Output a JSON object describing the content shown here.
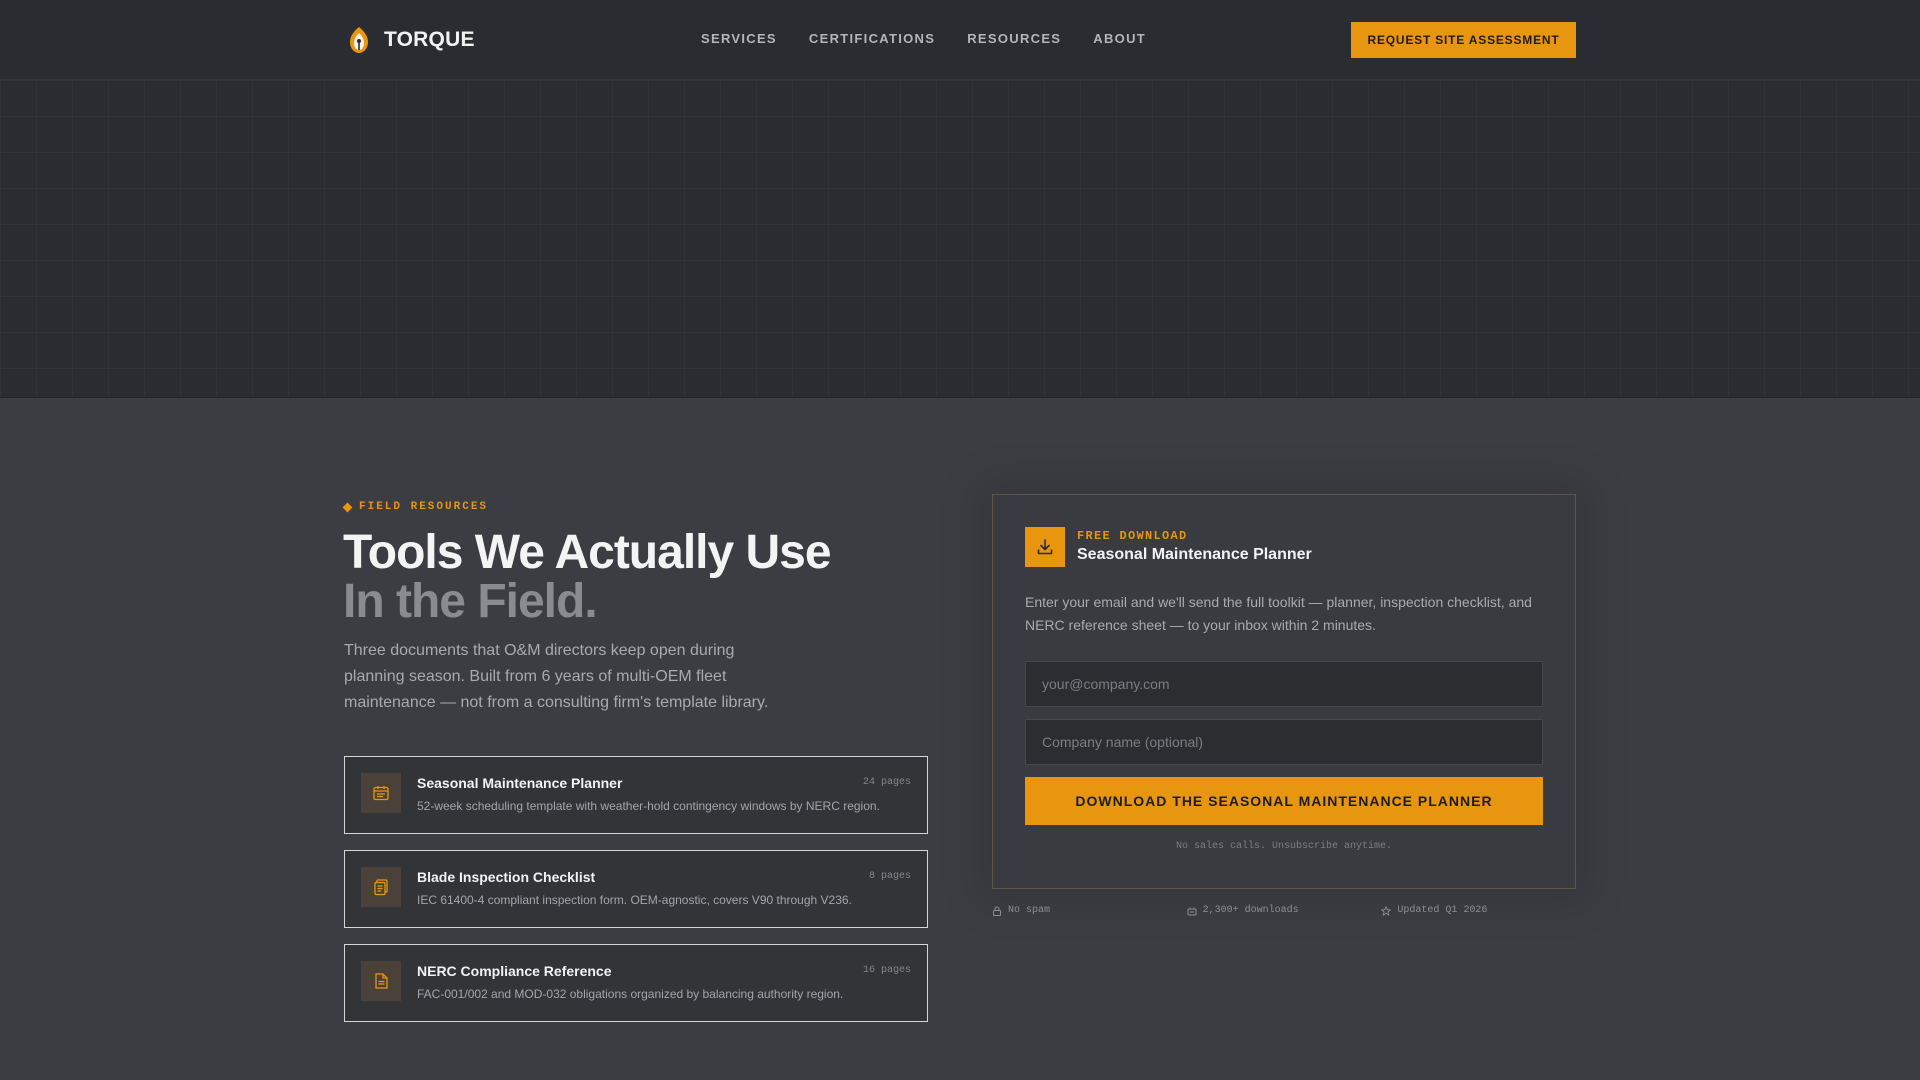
{
  "brand": {
    "name": "TORQUE",
    "logo_icon": "wind-turbine-logo-icon"
  },
  "nav": {
    "items": [
      {
        "label": "SERVICES"
      },
      {
        "label": "CERTIFICATIONS"
      },
      {
        "label": "RESOURCES"
      },
      {
        "label": "ABOUT"
      }
    ],
    "cta_label": "REQUEST SITE ASSESSMENT"
  },
  "hero": {
    "eyebrow": "FIELD RESOURCES",
    "headline_line1": "Tools We Actually Use",
    "headline_line2": "In the Field.",
    "intro": "Three documents that O&M directors keep open during planning season. Built from 6 years of multi-OEM fleet maintenance — not from a consulting firm's template library."
  },
  "resources": [
    {
      "title": "Seasonal Maintenance Planner",
      "description": "52-week scheduling template with weather-hold contingency windows by NERC region.",
      "pages": "24 pages",
      "icon": "calendar-icon"
    },
    {
      "title": "Blade Inspection Checklist",
      "description": "IEC 61400-4 compliant inspection form. OEM-agnostic, covers V90 through V236.",
      "pages": "8 pages",
      "icon": "clipboard-icon"
    },
    {
      "title": "NERC Compliance Reference",
      "description": "FAC-001/002 and MOD-032 obligations organized by balancing authority region.",
      "pages": "16 pages",
      "icon": "document-icon"
    }
  ],
  "download": {
    "eyebrow": "FREE DOWNLOAD",
    "title": "Seasonal Maintenance Planner",
    "description": "Enter your email and we'll send the full toolkit — planner, inspection checklist, and NERC reference sheet — to your inbox within 2 minutes.",
    "email_placeholder": "your@company.com",
    "company_placeholder": "Company name (optional)",
    "button_label": "DOWNLOAD THE SEASONAL MAINTENANCE PLANNER",
    "note": "No sales calls. Unsubscribe anytime."
  },
  "trust": [
    {
      "label": "No spam",
      "icon": "lock-icon"
    },
    {
      "label": "2,300+ downloads",
      "icon": "download-count-icon"
    },
    {
      "label": "Updated Q1 2026",
      "icon": "star-icon"
    }
  ],
  "colors": {
    "accent": "#e8950f",
    "background": "#3c3d42",
    "header_background": "#2b2c31"
  }
}
